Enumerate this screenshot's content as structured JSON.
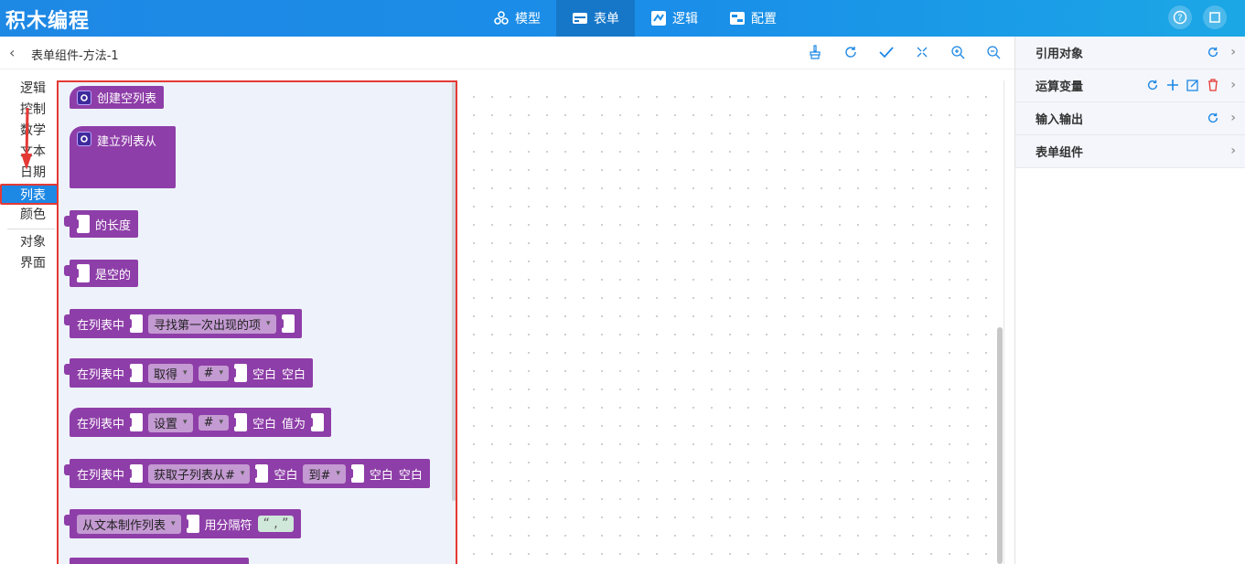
{
  "app": {
    "title": "积木编程"
  },
  "nav": {
    "tabs": [
      {
        "label": "模型",
        "icon": "cubes-icon"
      },
      {
        "label": "表单",
        "icon": "form-icon",
        "active": true
      },
      {
        "label": "逻辑",
        "icon": "logic-icon"
      },
      {
        "label": "配置",
        "icon": "config-icon"
      }
    ]
  },
  "header": {
    "breadcrumb": "表单组件-方法-1"
  },
  "categories": [
    "逻辑",
    "控制",
    "数学",
    "文本",
    "日期",
    "列表",
    "颜色",
    "对象",
    "界面"
  ],
  "active_category": "列表",
  "blocks": {
    "create_empty": "创建空列表",
    "create_from": "建立列表从",
    "length_of": "的长度",
    "is_empty": "是空的",
    "in_list": "在列表中",
    "find_first": "寻找第一次出现的项",
    "get": "取得",
    "hash": "#",
    "blank": "空白",
    "set": "设置",
    "value_as": "值为",
    "get_sublist": "获取子列表从#",
    "to_hash": "到#",
    "from_text": "从文本制作列表",
    "with_sep": "用分隔符",
    "sep_value": "“ , ”"
  },
  "right_panel": {
    "rows": [
      {
        "label": "引用对象"
      },
      {
        "label": "运算变量"
      },
      {
        "label": "输入输出"
      },
      {
        "label": "表单组件"
      }
    ]
  },
  "colors": {
    "accent": "#1e88e5",
    "block": "#8e3ea8",
    "highlight": "#e53935"
  }
}
